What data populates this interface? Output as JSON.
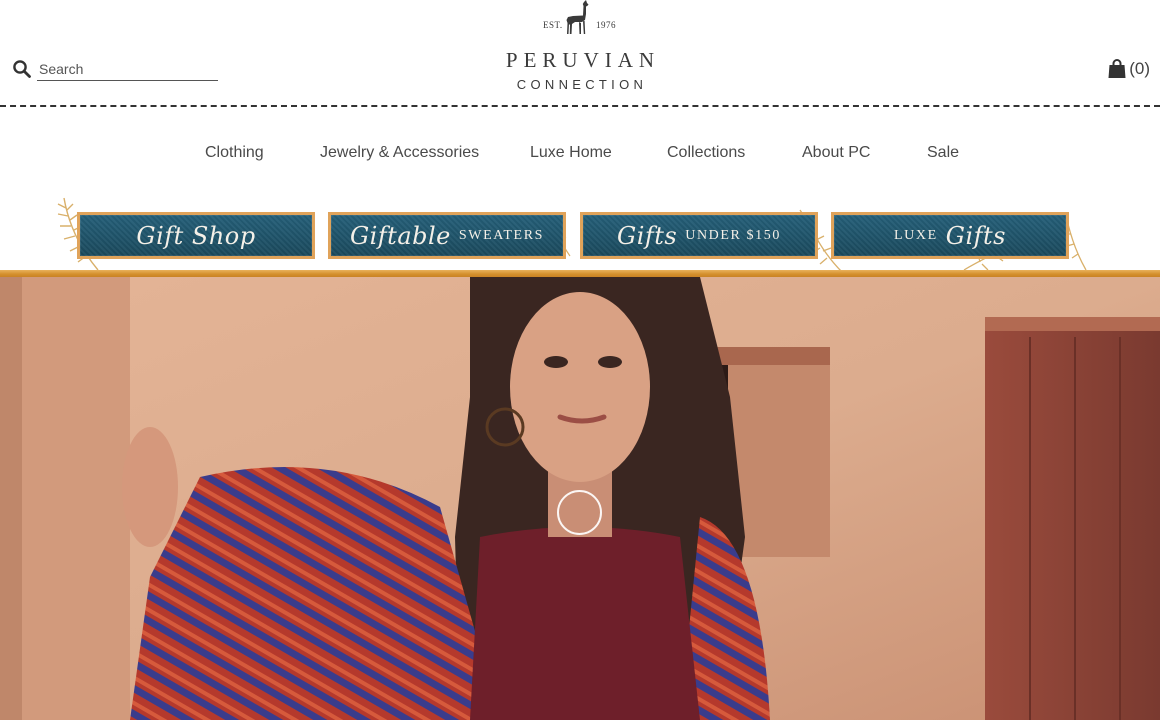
{
  "header": {
    "search": {
      "placeholder": "Search",
      "value": ""
    },
    "logo": {
      "est": "EST.",
      "year": "1976",
      "main": "PERUVIAN",
      "sub": "CONNECTION"
    },
    "cart": {
      "count": "(0)"
    }
  },
  "nav": {
    "items": [
      {
        "label": "Clothing"
      },
      {
        "label": "Jewelry & Accessories"
      },
      {
        "label": "Luxe Home"
      },
      {
        "label": "Collections"
      },
      {
        "label": "About PC"
      },
      {
        "label": "Sale"
      }
    ]
  },
  "gift_banner": {
    "buttons": [
      {
        "script": "Gift Shop",
        "caps": ""
      },
      {
        "script": "Giftable",
        "caps": "SWEATERS"
      },
      {
        "script": "Gifts",
        "caps": "UNDER $150"
      },
      {
        "caps": "LUXE",
        "script": "Gifts"
      }
    ]
  },
  "colors": {
    "banner_teal": "#1f5366",
    "banner_border": "#e0a35a",
    "gold_rule": "#d48f2c",
    "text": "#3a3a3a"
  },
  "icons": {
    "search": "magnifier-icon",
    "cart": "shopping-bag-icon",
    "logo": "llama-icon",
    "loading": "spinner-icon"
  }
}
